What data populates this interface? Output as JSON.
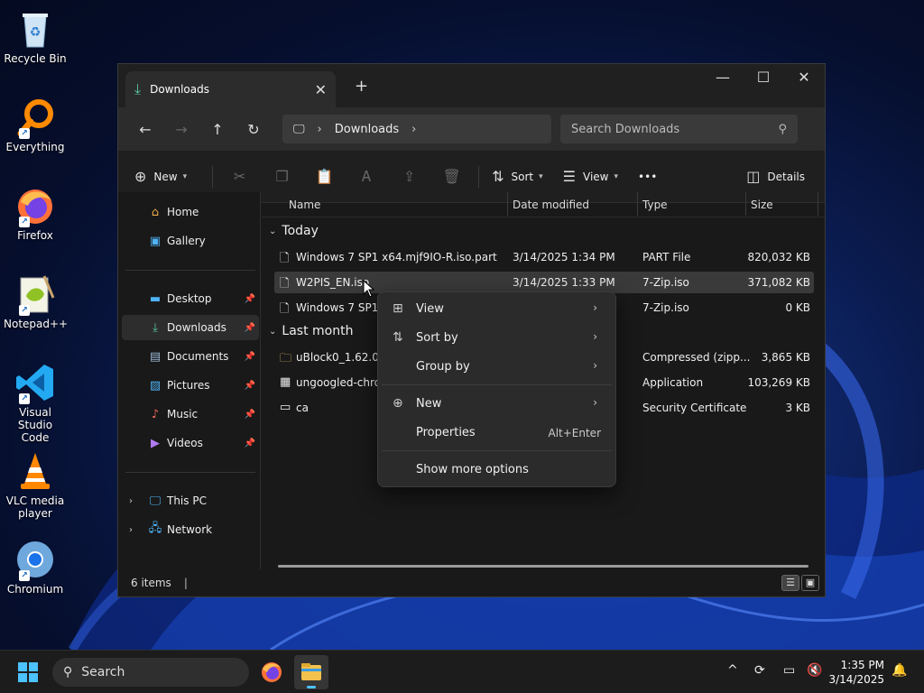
{
  "desktop": {
    "icons": [
      {
        "label": "Recycle Bin"
      },
      {
        "label": "Everything"
      },
      {
        "label": "Firefox"
      },
      {
        "label": "Notepad++"
      },
      {
        "label": "Visual Studio Code"
      },
      {
        "label": "VLC media player"
      },
      {
        "label": "Chromium"
      }
    ]
  },
  "window": {
    "tab_title": "Downloads",
    "new_tab": "+",
    "breadcrumb": [
      "Downloads"
    ],
    "search_placeholder": "Search Downloads",
    "toolbar": {
      "new_label": "New",
      "sort_label": "Sort",
      "view_label": "View",
      "more_label": "•••",
      "details_label": "Details"
    }
  },
  "sidebar": {
    "items": [
      {
        "label": "Home",
        "icon": "home-icon"
      },
      {
        "label": "Gallery",
        "icon": "gallery-icon"
      },
      {
        "label": "Desktop",
        "icon": "desktop-folder-icon"
      },
      {
        "label": "Downloads",
        "icon": "downloads-folder-icon"
      },
      {
        "label": "Documents",
        "icon": "documents-folder-icon"
      },
      {
        "label": "Pictures",
        "icon": "pictures-folder-icon"
      },
      {
        "label": "Music",
        "icon": "music-folder-icon"
      },
      {
        "label": "Videos",
        "icon": "videos-folder-icon"
      },
      {
        "label": "This PC",
        "icon": "computer-icon"
      },
      {
        "label": "Network",
        "icon": "network-icon"
      }
    ]
  },
  "columns": {
    "name": "Name",
    "date": "Date modified",
    "type": "Type",
    "size": "Size"
  },
  "groups": {
    "today": "Today",
    "last_month": "Last month"
  },
  "files": [
    {
      "name": "Windows 7 SP1 x64.mjf9IO-R.iso.part",
      "date": "3/14/2025 1:34 PM",
      "type": "PART File",
      "size": "820,032 KB"
    },
    {
      "name": "W2PIS_EN.iso",
      "date": "3/14/2025 1:33 PM",
      "type": "7-Zip.iso",
      "size": "371,082 KB"
    },
    {
      "name": "Windows 7 SP1 x",
      "date": "",
      "type": "7-Zip.iso",
      "size": "0 KB"
    },
    {
      "name": "uBlock0_1.62.0.ch",
      "date": "",
      "type": "Compressed (zipp...",
      "size": "3,865 KB"
    },
    {
      "name": "ungoogled-chron",
      "date": "",
      "type": "Application",
      "size": "103,269 KB"
    },
    {
      "name": "ca",
      "date": "",
      "type": "Security Certificate",
      "size": "3 KB"
    }
  ],
  "context_menu": {
    "items": [
      {
        "label": "View"
      },
      {
        "label": "Sort by"
      },
      {
        "label": "Group by"
      },
      {
        "label": "New"
      },
      {
        "label": "Properties",
        "shortcut": "Alt+Enter"
      },
      {
        "label": "Show more options"
      }
    ]
  },
  "status": {
    "count": "6 items"
  },
  "taskbar": {
    "search_label": "Search",
    "time": "1:35 PM",
    "date": "3/14/2025"
  },
  "colors": {
    "accent": "#4cc2ff",
    "window_bg": "#191919"
  }
}
